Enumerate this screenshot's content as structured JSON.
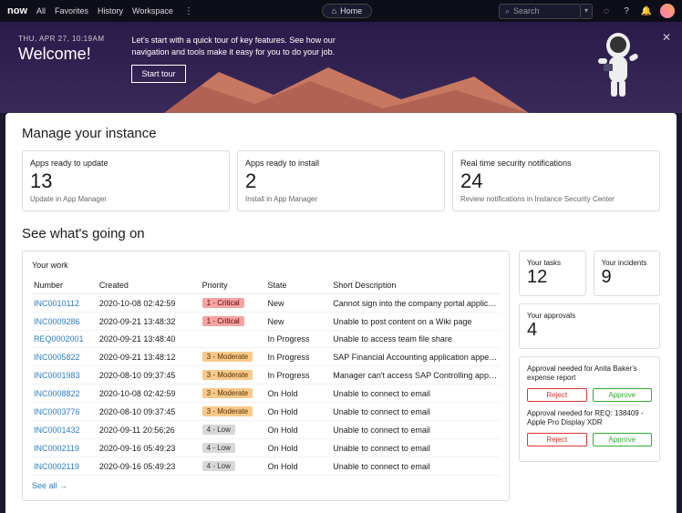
{
  "topbar": {
    "logo": "now",
    "nav": [
      "All",
      "Favorites",
      "History",
      "Workspace"
    ],
    "home": "Home",
    "search_placeholder": "Search"
  },
  "banner": {
    "date": "THU, APR 27, 10:19AM",
    "title": "Welcome!",
    "text": "Let's start with a quick tour of key features. See how our navigation and tools make it easy for you to do your job.",
    "button": "Start tour"
  },
  "manage": {
    "heading": "Manage your instance",
    "cards": [
      {
        "title": "Apps ready to update",
        "num": "13",
        "link": "Update in App Manager"
      },
      {
        "title": "Apps ready to install",
        "num": "2",
        "link": "Install in App Manager"
      },
      {
        "title": "Real time security notifications",
        "num": "24",
        "link": "Review notifications in Instance Security Center"
      }
    ]
  },
  "going": {
    "heading": "See what's going on",
    "work_title": "Your work",
    "cols": [
      "Number",
      "Created",
      "Priority",
      "State",
      "Short Description"
    ],
    "rows": [
      {
        "n": "INC0010112",
        "c": "2020-10-08 02:42:59",
        "p": "1 - Critical",
        "pc": "b-crit",
        "s": "New",
        "d": "Cannot sign into the company portal application…"
      },
      {
        "n": "INC0009286",
        "c": "2020-09-21 13:48:32",
        "p": "1 - Critical",
        "pc": "b-crit",
        "s": "New",
        "d": "Unable to post content on a Wiki page"
      },
      {
        "n": "REQ0002001",
        "c": "2020-09-21 13:48:40",
        "p": "",
        "pc": "",
        "s": "In Progress",
        "d": "Unable to access team file share"
      },
      {
        "n": "INC0005822",
        "c": "2020-09-21 13:48:12",
        "p": "3 - Moderate",
        "pc": "b-mod",
        "s": "In Progress",
        "d": "SAP Financial Accounting application appears to…"
      },
      {
        "n": "INC0001983",
        "c": "2020-08-10 09:37:45",
        "p": "3 - Moderate",
        "pc": "b-mod",
        "s": "In Progress",
        "d": "Manager can't access SAP Controlling applicatio…"
      },
      {
        "n": "INC0008822",
        "c": "2020-10-08 02:42:59",
        "p": "3 - Moderate",
        "pc": "b-mod",
        "s": "On Hold",
        "d": "Unable to connect to email"
      },
      {
        "n": "INC0003776",
        "c": "2020-08-10 09:37:45",
        "p": "3 - Moderate",
        "pc": "b-mod",
        "s": "On Hold",
        "d": "Unable to connect to email"
      },
      {
        "n": "INC0001432",
        "c": "2020-09-11 20:56:26",
        "p": "4 - Low",
        "pc": "b-low",
        "s": "On Hold",
        "d": "Unable to connect to email"
      },
      {
        "n": "INC0002119",
        "c": "2020-09-16 05:49:23",
        "p": "4 - Low",
        "pc": "b-low",
        "s": "On Hold",
        "d": "Unable to connect to email"
      },
      {
        "n": "INC0002119",
        "c": "2020-09-16 05:49:23",
        "p": "4 - Low",
        "pc": "b-low",
        "s": "On Hold",
        "d": "Unable to connect to email"
      }
    ],
    "seeall": "See all",
    "tasks": {
      "title": "Your tasks",
      "num": "12"
    },
    "incidents": {
      "title": "Your incidents",
      "num": "9"
    },
    "approvals": {
      "title": "Your approvals",
      "num": "4",
      "items": [
        "Approval needed for Anita Baker's expense report",
        "Approval needed for REQ: 138409 - Apple Pro Display XDR"
      ],
      "reject": "Reject",
      "approve": "Approve"
    }
  }
}
